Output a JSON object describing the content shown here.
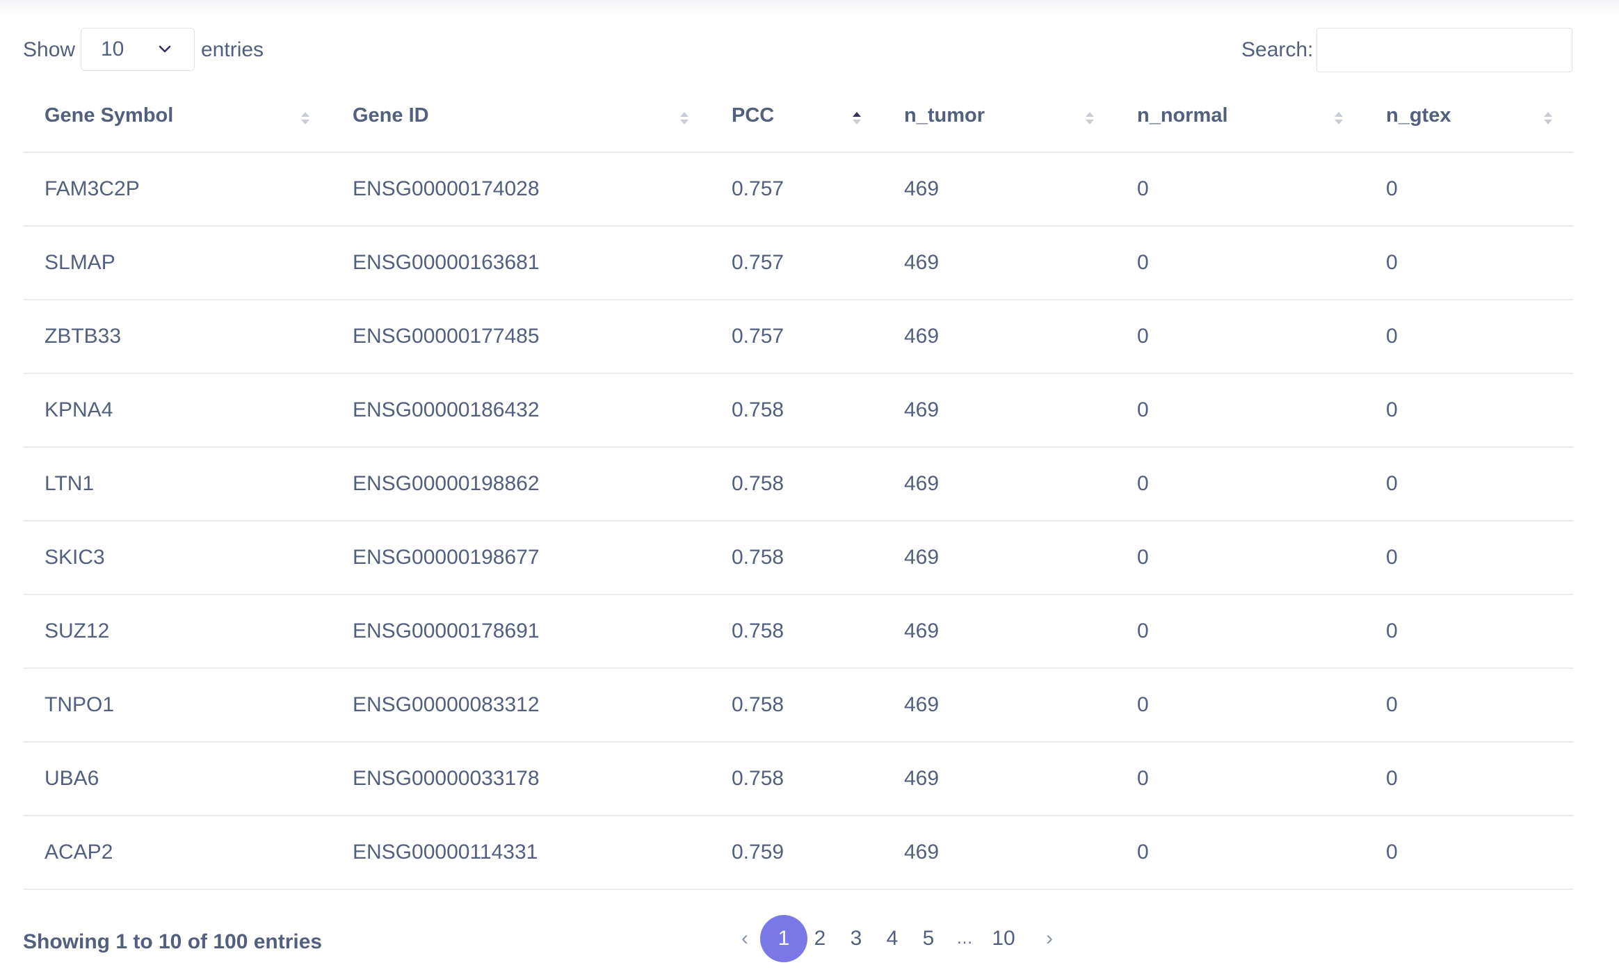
{
  "controls": {
    "show_label": "Show",
    "length_value": "10",
    "entries_label": "entries",
    "search_label": "Search:",
    "search_value": ""
  },
  "table": {
    "headers": [
      "Gene Symbol",
      "Gene ID",
      "PCC",
      "n_tumor",
      "n_normal",
      "n_gtex"
    ],
    "sorted_column": "PCC",
    "sort_direction": "ascending",
    "rows": [
      [
        "FAM3C2P",
        "ENSG00000174028",
        "0.757",
        "469",
        "0",
        "0"
      ],
      [
        "SLMAP",
        "ENSG00000163681",
        "0.757",
        "469",
        "0",
        "0"
      ],
      [
        "ZBTB33",
        "ENSG00000177485",
        "0.757",
        "469",
        "0",
        "0"
      ],
      [
        "KPNA4",
        "ENSG00000186432",
        "0.758",
        "469",
        "0",
        "0"
      ],
      [
        "LTN1",
        "ENSG00000198862",
        "0.758",
        "469",
        "0",
        "0"
      ],
      [
        "SKIC3",
        "ENSG00000198677",
        "0.758",
        "469",
        "0",
        "0"
      ],
      [
        "SUZ12",
        "ENSG00000178691",
        "0.758",
        "469",
        "0",
        "0"
      ],
      [
        "TNPO1",
        "ENSG00000083312",
        "0.758",
        "469",
        "0",
        "0"
      ],
      [
        "UBA6",
        "ENSG00000033178",
        "0.758",
        "469",
        "0",
        "0"
      ],
      [
        "ACAP2",
        "ENSG00000114331",
        "0.759",
        "469",
        "0",
        "0"
      ]
    ]
  },
  "footer": {
    "info": "Showing 1 to 10 of 100 entries",
    "pages": [
      "1",
      "2",
      "3",
      "4",
      "5",
      "…",
      "10"
    ],
    "current_page": "1",
    "prev_icon": "chevron-left-icon",
    "next_icon": "chevron-right-icon"
  },
  "colors": {
    "accent": "#7a78e6",
    "text": "#525f7f",
    "border": "#e9ecef"
  }
}
